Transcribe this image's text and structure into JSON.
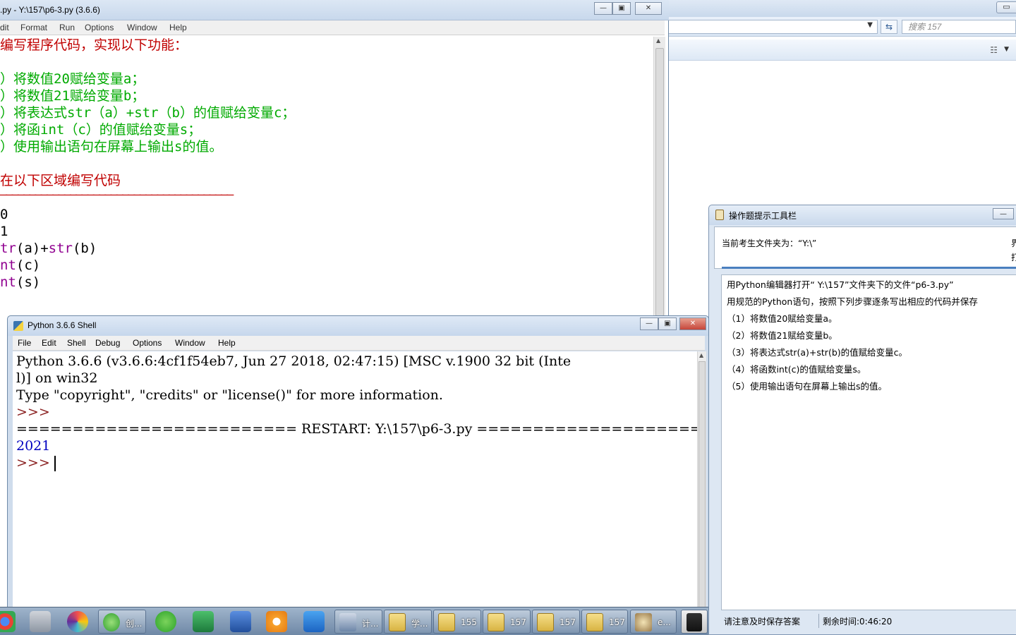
{
  "editor": {
    "title": ".py - Y:\\157\\p6-3.py (3.6.6)",
    "menu": [
      "dit",
      "Format",
      "Run",
      "Options",
      "Window",
      "Help"
    ],
    "lines": [
      {
        "text": "编写程序代码，实现以下功能：",
        "color": "#c00000"
      },
      {
        "text": "",
        "color": "#000000"
      },
      {
        "text": "）将数值20赋给变量a；",
        "color": "#00aa00"
      },
      {
        "text": "）将数值21赋给变量b；",
        "color": "#00aa00"
      },
      {
        "text": "）将表达式str（a）+str（b）的值赋给变量c；",
        "color": "#00aa00"
      },
      {
        "text": "）将函int（c）的值赋给变量s；",
        "color": "#00aa00"
      },
      {
        "text": "）使用输出语句在屏幕上输出s的值。",
        "color": "#00aa00"
      },
      {
        "text": "",
        "color": "#000000"
      },
      {
        "text": "在以下区域编写代码",
        "color": "#c00000"
      },
      {
        "text": "————————————————————————————————————————",
        "color": "#c00000"
      },
      {
        "text": "0",
        "color": "#000000"
      },
      {
        "text": "1",
        "color": "#000000"
      }
    ],
    "code_line_str": {
      "k1": "tr",
      "a": "(a)+",
      "k2": "str",
      "b": "(b)"
    },
    "code_line_int": {
      "k": "nt",
      "rest": "(c)"
    },
    "code_line_print": {
      "k": "nt",
      "rest": "(s)"
    }
  },
  "shell": {
    "title": "Python 3.6.6 Shell",
    "menu": [
      "File",
      "Edit",
      "Shell",
      "Debug",
      "Options",
      "Window",
      "Help"
    ],
    "banner_1": "Python 3.6.6 (v3.6.6:4cf1f54eb7, Jun 27 2018, 02:47:15) [MSC v.1900 32 bit (Inte",
    "banner_2": "l)] on win32",
    "banner_3": "Type \"copyright\", \"credits\" or \"license()\" for more information.",
    "prompt": ">>>",
    "restart": "========================= RESTART: Y:\\157\\p6-3.py =========================",
    "output": "2021"
  },
  "explorer": {
    "search_placeholder": "搜索 157"
  },
  "hint": {
    "title": "操作题提示工具栏",
    "folder_label": "当前考生文件夹为：“Y:\\”",
    "side_char_1": "界",
    "side_char_2": "打",
    "lines": [
      "用Python编辑器打开“ Y:\\157”文件夹下的文件“p6-3.py”",
      "用规范的Python语句，按照下列步骤逐条写出相应的代码并保存",
      "（1）将数值20赋给变量a。",
      "（2）将数值21赋给变量b。",
      "（3）将表达式str(a)+str(b)的值赋给变量c。",
      "（4）将函数int(c)的值赋给变量s。",
      "（5）使用输出语句在屏幕上输出s的值。"
    ],
    "status_left": "请注意及时保存答案",
    "status_right": "剩余时间:0:46:20"
  },
  "taskbar": {
    "items": [
      {
        "name": "chrome-icon",
        "label": ""
      },
      {
        "name": "settings-tool-icon",
        "label": ""
      },
      {
        "name": "colorful-app-icon",
        "label": ""
      },
      {
        "name": "green-app-icon",
        "label": "创..."
      },
      {
        "name": "wechat-icon",
        "label": ""
      },
      {
        "name": "excel-icon",
        "label": ""
      },
      {
        "name": "word-icon",
        "label": ""
      },
      {
        "name": "orange-app-icon",
        "label": ""
      },
      {
        "name": "blue-grid-icon",
        "label": ""
      },
      {
        "name": "computer-icon",
        "label": "计..."
      },
      {
        "name": "folder-icon",
        "label": "学..."
      },
      {
        "name": "folder-icon",
        "label": "155"
      },
      {
        "name": "folder-icon",
        "label": "157"
      },
      {
        "name": "folder-icon",
        "label": "157"
      },
      {
        "name": "folder-icon",
        "label": "157"
      },
      {
        "name": "paint-icon",
        "label": "e..."
      },
      {
        "name": "pen-icon",
        "label": ""
      }
    ]
  }
}
